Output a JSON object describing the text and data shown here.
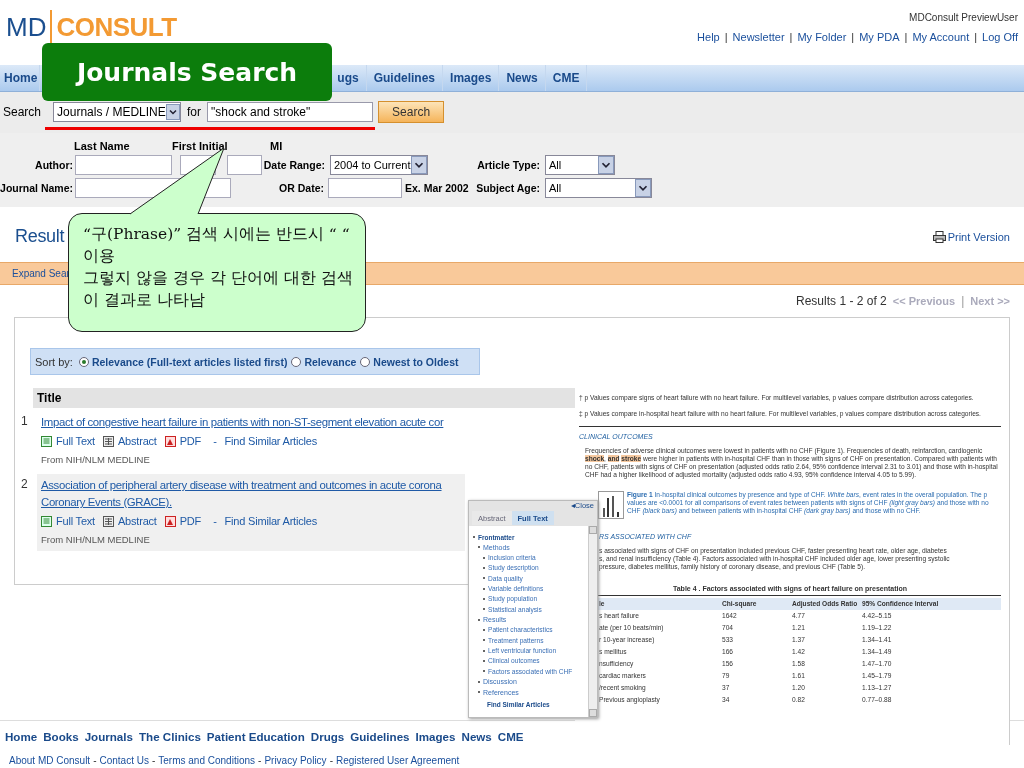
{
  "annotation_label": {
    "text": "Journals Search"
  },
  "header": {
    "logo": {
      "left": "MD",
      "right": "CONSULT"
    },
    "user": "MDConsult PreviewUser",
    "links": [
      "Help",
      "Newsletter",
      "My Folder",
      "My PDA",
      "My Account",
      "Log Off"
    ],
    "separator": "|"
  },
  "nav": [
    "Home",
    "ugs",
    "Guidelines",
    "Images",
    "News",
    "CME"
  ],
  "search": {
    "label": "Search",
    "scope": "Journals / MEDLINE",
    "for": "for",
    "query": "\"shock and stroke\"",
    "button": "Search"
  },
  "form": {
    "columns": [
      "Last Name",
      "First Initial",
      "MI"
    ],
    "author_label": "Author:",
    "journal_label": "Journal Name:",
    "date_range_label": "Date Range:",
    "date_range": "2004 to Current",
    "or_date_label": "OR Date:",
    "date_example": "Ex. Mar 2002",
    "article_type_label": "Article Type:",
    "article_type": "All",
    "subject_age_label": "Subject Age:",
    "subject_age": "All"
  },
  "results": {
    "heading": "Result",
    "print": "Print Version",
    "expand": "Expand Sear",
    "count": "Results 1 - 2 of 2",
    "previous": "<< Previous",
    "separator": "|",
    "next": "Next >>",
    "sort_label": "Sort by:",
    "sort_options": [
      {
        "label": "Relevance (Full-text articles listed first)",
        "selected": true
      },
      {
        "label": "Relevance",
        "selected": false
      },
      {
        "label": "Newest to Oldest",
        "selected": false
      }
    ],
    "column": "Title",
    "rows": [
      {
        "number": "1",
        "title": [
          "Impact of congestive heart failure in patients with non-ST-segment elevation acute cor"
        ],
        "full_text": "Full Text",
        "abstract": "Abstract",
        "pdf": "PDF",
        "dash": "-",
        "similar": "Find Similar Articles",
        "source": "From NIH/NLM MEDLINE"
      },
      {
        "number": "2",
        "title": [
          "Association of peripheral artery disease with treatment and outcomes in acute corona",
          "Coronary Events (GRACE)."
        ],
        "full_text": "Full Text",
        "abstract": "Abstract",
        "pdf": "PDF",
        "dash": "-",
        "similar": "Find Similar Articles",
        "source": "From NIH/NLM MEDLINE"
      }
    ]
  },
  "callout": {
    "lines": [
      "“구(Phrase)” 검색 시에는 반드시 “ “ 이용",
      "그렇지 않을 경우 각 단어에 대한 검색이 결과로 나타남"
    ]
  },
  "article": {
    "footnotes": [
      "† p Values compare signs of heart failure with no heart failure. For multilevel variables, p values compare distribution across categories.",
      "‡ p Values compare in-hospital heart failure with no heart failure. For multilevel variables, p values compare distribution across categories."
    ],
    "heading": "CLINICAL OUTCOMES",
    "paragraph": "Frequencies of adverse clinical outcomes were lowest in patients with no CHF (Figure 1). Frequencies of death, reinfarction, cardiogenic **shock**, **and** **stroke** were higher in patients with in-hospital CHF than in those with signs of CHF on presentation. Compared with patients with no CHF, patients with signs of CHF on presentation (adjusted odds ratio 2.64, 95% confidence interval 2.31 to 3.01) and those with in-hospital CHF had a higher likelihood of adjusted mortality (adjusted odds ratio 4.93, 95% confidence interval 4.05 to 5.99).",
    "figure_caption": "**Figure 1**  In-hospital clinical outcomes by presence and type of CHF. *White bars*, event rates in the overall population. The p values are <0.0001 for all comparisons of event rates between patients with signs of CHF *(light gray bars)* and those with no CHF *(black bars)* and between patients with in-hospital CHF *(dark gray bars)* and those with no CHF.",
    "heading_2": "RS ASSOCIATED WITH CHF",
    "paragraph_2_lines": [
      "s associated with signs of CHF on presentation included previous CHF, faster presenting heart rate, older age, diabetes",
      "s, and renal insufficiency (Table 4). Factors associated with in-hospital CHF included older age, lower presenting systolic",
      "pressure, diabetes mellitus, family history of coronary disease, and previous CHF (Table 5)."
    ],
    "table_title": "Table 4 . Factors associated with signs of heart failure on presentation",
    "table_columns": [
      "le",
      "Chi-square",
      "Adjusted Odds Ratio",
      "95% Confidence Interval"
    ],
    "table_rows": [
      [
        "s heart failure",
        "1642",
        "4.77",
        "4.42–5.15"
      ],
      [
        "ate (per 10 beats/min)",
        "704",
        "1.21",
        "1.19–1.22"
      ],
      [
        "r 10-year increase)",
        "533",
        "1.37",
        "1.34–1.41"
      ],
      [
        "s mellitus",
        "166",
        "1.42",
        "1.34–1.49"
      ],
      [
        "nsufficiency",
        "156",
        "1.58",
        "1.47–1.70"
      ],
      [
        "cardiac markers",
        "79",
        "1.61",
        "1.45–1.79"
      ],
      [
        "/recent smoking",
        "37",
        "1.20",
        "1.13–1.27"
      ],
      [
        "Previous angioplasty",
        "34",
        "0.82",
        "0.77–0.88"
      ]
    ]
  },
  "toc": {
    "close": "◂Close",
    "tabs": [
      {
        "label": "Abstract",
        "selected": false
      },
      {
        "label": "Full Text",
        "selected": true
      }
    ],
    "items": [
      {
        "label": "Frontmatter",
        "children": [
          {
            "label": "Methods",
            "children": [
              {
                "label": "Inclusion criteria"
              },
              {
                "label": "Study description"
              },
              {
                "label": "Data quality"
              },
              {
                "label": "Variable definitions"
              },
              {
                "label": "Study population"
              },
              {
                "label": "Statistical analysis"
              }
            ]
          },
          {
            "label": "Results",
            "children": [
              {
                "label": "Patient characteristics"
              },
              {
                "label": "Treatment patterns"
              },
              {
                "label": "Left ventricular function"
              },
              {
                "label": "Clinical outcomes"
              },
              {
                "label": "Factors associated with CHF"
              }
            ]
          },
          {
            "label": "Discussion"
          },
          {
            "label": "References"
          }
        ]
      }
    ],
    "similar": "Find Similar Articles"
  },
  "footer": {
    "nav": [
      "Home",
      "Books",
      "Journals",
      "The Clinics",
      "Patient Education",
      "Drugs",
      "Guidelines",
      "Images",
      "News",
      "CME"
    ],
    "links": [
      "About MD Consult",
      "Contact Us",
      "Terms and Conditions",
      "Privacy Policy",
      "Registered User Agreement"
    ],
    "separator": "-"
  }
}
